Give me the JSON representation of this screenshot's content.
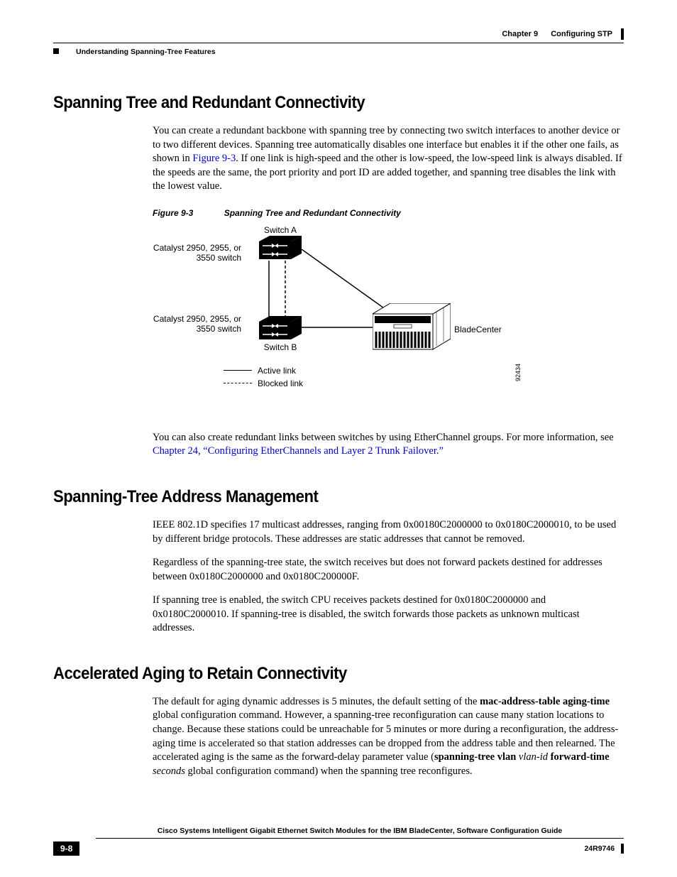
{
  "header": {
    "chapter_prefix": "Chapter 9",
    "chapter_title": "Configuring STP",
    "subheader": "Understanding Spanning-Tree Features"
  },
  "section1": {
    "title": "Spanning Tree and Redundant Connectivity",
    "p1_a": "You can create a redundant backbone with spanning tree by connecting two switch interfaces to another device or to two different devices. Spanning tree automatically disables one interface but enables it if the other one fails, as shown in ",
    "p1_link": "Figure 9-3",
    "p1_b": ". If one link is high-speed and the other is low-speed, the low-speed link is always disabled. If the speeds are the same, the port priority and port ID are added together, and spanning tree disables the link with the lowest value.",
    "fig_num": "Figure 9-3",
    "fig_title": "Spanning Tree and Redundant Connectivity",
    "fig": {
      "switch_a": "Switch A",
      "switch_b": "Switch B",
      "left_label": "Catalyst 2950, 2955, or 3550 switch",
      "bladecenter": "BladeCenter",
      "active": "Active link",
      "blocked": "Blocked link",
      "figid": "92434"
    },
    "p2_a": "You can also create redundant links between switches by using EtherChannel groups. For more information, see ",
    "p2_link": "Chapter 24, “Configuring EtherChannels and Layer 2 Trunk Failover.”"
  },
  "section2": {
    "title": "Spanning-Tree Address Management",
    "p1": "IEEE 802.1D specifies 17 multicast addresses, ranging from 0x00180C2000000 to 0x0180C2000010, to be used by different bridge protocols. These addresses are static addresses that cannot be removed.",
    "p2": "Regardless of the spanning-tree state, the switch receives but does not forward packets destined for addresses between 0x0180C2000000 and 0x0180C200000F.",
    "p3": "If spanning tree is enabled, the switch CPU receives packets destined for 0x0180C2000000 and 0x0180C2000010. If spanning-tree is disabled, the switch forwards those packets as unknown multicast addresses."
  },
  "section3": {
    "title": "Accelerated Aging to Retain Connectivity",
    "p1_a": "The default for aging dynamic addresses is 5 minutes, the default setting of the ",
    "p1_bold1": "mac-address-table aging-time",
    "p1_b": " global configuration command. However, a spanning-tree reconfiguration can cause many station locations to change. Because these stations could be unreachable for 5 minutes or more during a reconfiguration, the address-aging time is accelerated so that station addresses can be dropped from the address table and then relearned. The accelerated aging is the same as the forward-delay parameter value (",
    "p1_bold2": "spanning-tree vlan",
    "p1_c": " ",
    "p1_ital1": "vlan-id",
    "p1_d": " ",
    "p1_bold3": "forward-time",
    "p1_e": " ",
    "p1_ital2": "seconds",
    "p1_f": " global configuration command) when the spanning tree reconfigures."
  },
  "footer": {
    "title": "Cisco Systems Intelligent Gigabit Ethernet Switch Modules for the IBM BladeCenter, Software Configuration Guide",
    "page": "9-8",
    "docid": "24R9746"
  }
}
